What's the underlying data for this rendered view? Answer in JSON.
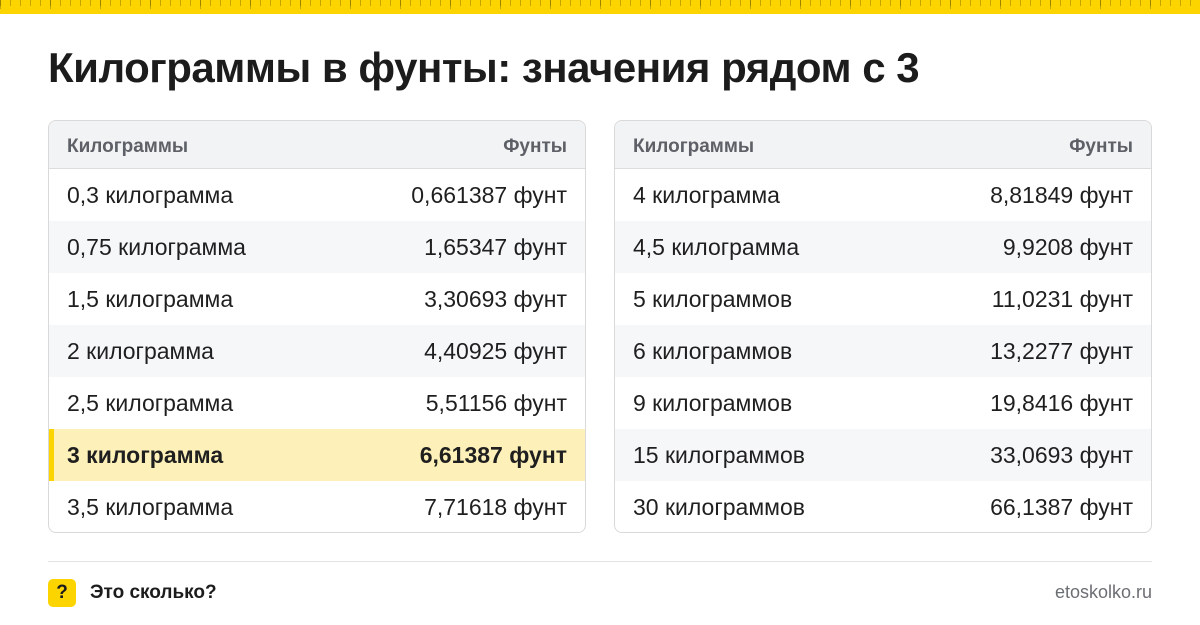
{
  "title": "Килограммы в фунты: значения рядом с 3",
  "tables": [
    {
      "header": {
        "col1": "Килограммы",
        "col2": "Фунты"
      },
      "rows": [
        {
          "kg": "0,3 килограмма",
          "lb": "0,661387 фунт"
        },
        {
          "kg": "0,75 килограмма",
          "lb": "1,65347 фунт"
        },
        {
          "kg": "1,5 килограмма",
          "lb": "3,30693 фунт"
        },
        {
          "kg": "2 килограмма",
          "lb": "4,40925 фунт"
        },
        {
          "kg": "2,5 килограмма",
          "lb": "5,51156 фунт"
        },
        {
          "kg": "3 килограмма",
          "lb": "6,61387 фунт",
          "highlighted": true
        },
        {
          "kg": "3,5 килограмма",
          "lb": "7,71618 фунт"
        }
      ]
    },
    {
      "header": {
        "col1": "Килограммы",
        "col2": "Фунты"
      },
      "rows": [
        {
          "kg": "4 килограмма",
          "lb": "8,81849 фунт"
        },
        {
          "kg": "4,5 килограмма",
          "lb": "9,9208 фунт"
        },
        {
          "kg": "5 килограммов",
          "lb": "11,0231 фунт"
        },
        {
          "kg": "6 килограммов",
          "lb": "13,2277 фунт"
        },
        {
          "kg": "9 килограммов",
          "lb": "19,8416 фунт"
        },
        {
          "kg": "15 килограммов",
          "lb": "33,0693 фунт"
        },
        {
          "kg": "30 килограммов",
          "lb": "66,1387 фунт"
        }
      ]
    }
  ],
  "footer": {
    "icon": "question-mark-icon",
    "icon_glyph": "?",
    "brand": "Это сколько?",
    "site": "etoskolko.ru"
  },
  "colors": {
    "accent": "#fcd400",
    "highlight_row": "#fdf0b8",
    "header_bg": "#f2f3f5"
  }
}
